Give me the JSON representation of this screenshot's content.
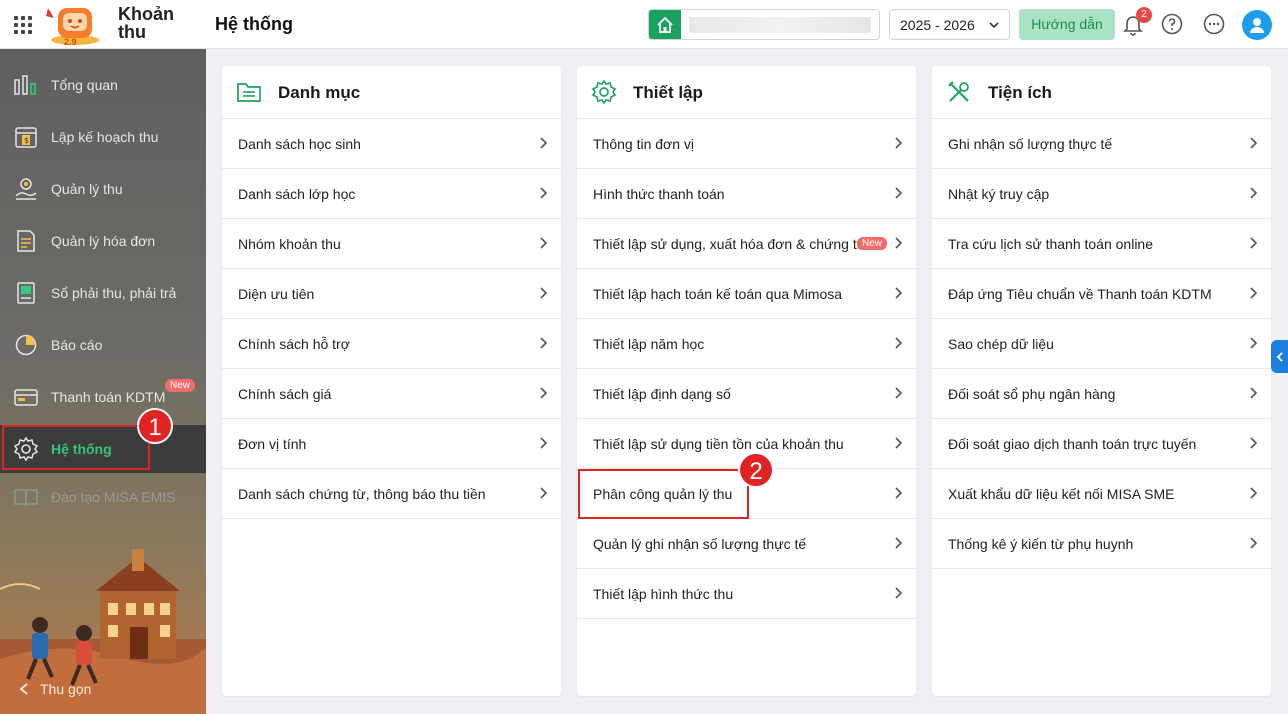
{
  "topbar": {
    "app_name_line1": "Khoản",
    "app_name_line2": "thu",
    "page_title": "Hệ thống",
    "school_year": "2025 - 2026",
    "guide_label": "Hướng dẫn",
    "notification_count": "2"
  },
  "sidebar": {
    "items": [
      {
        "label": "Tổng quan",
        "icon": "chart-bars-icon"
      },
      {
        "label": "Lập kế hoạch thu",
        "icon": "calendar-dollar-icon"
      },
      {
        "label": "Quản lý thu",
        "icon": "coin-hand-icon"
      },
      {
        "label": "Quản lý hóa đơn",
        "icon": "invoice-icon"
      },
      {
        "label": "Sổ phải thu, phải trả",
        "icon": "ledger-icon"
      },
      {
        "label": "Báo cáo",
        "icon": "pie-chart-icon"
      },
      {
        "label": "Thanh toán KDTM",
        "icon": "card-icon",
        "badge": "New"
      },
      {
        "label": "Hệ thống",
        "icon": "gear-icon"
      },
      {
        "label": "Đào tạo MISA EMIS",
        "icon": "book-icon"
      }
    ],
    "collapse_label": "Thu gọn"
  },
  "markers": {
    "one": "1",
    "two": "2"
  },
  "cards": {
    "danh_muc": {
      "title": "Danh mục",
      "rows": [
        "Danh sách học sinh",
        "Danh sách lớp học",
        "Nhóm khoản thu",
        "Diện ưu tiên",
        "Chính sách hỗ trợ",
        "Chính sách giá",
        "Đơn vị tính",
        "Danh sách chứng từ, thông báo thu tiền"
      ]
    },
    "thiet_lap": {
      "title": "Thiết lập",
      "rows": [
        "Thông tin đơn vị",
        "Hình thức thanh toán",
        "Thiết lập sử dụng, xuất hóa đơn & chứng từ",
        "Thiết lập hạch toán kế toán qua Mimosa",
        "Thiết lập năm học",
        "Thiết lập định dạng số",
        "Thiết lập sử dụng tiền tồn của khoản thu",
        "Phân công quản lý thu",
        "Quản lý ghi nhận số lượng thực tế",
        "Thiết lập hình thức thu"
      ],
      "new_badge": "New"
    },
    "tien_ich": {
      "title": "Tiện ích",
      "rows": [
        "Ghi nhận số lượng thực tế",
        "Nhật ký truy cập",
        "Tra cứu lịch sử thanh toán online",
        "Đáp ứng Tiêu chuẩn về Thanh toán KDTM",
        "Sao chép dữ liệu",
        "Đối soát sổ phụ ngân hàng",
        "Đối soát giao dịch thanh toán trực tuyến",
        "Xuất khẩu dữ liệu kết nối MISA SME",
        "Thống kê ý kiến từ phụ huynh"
      ]
    }
  },
  "colors": {
    "accent_green": "#1aa260",
    "active_text": "#35c57a",
    "highlight_red": "#e02424",
    "badge_red": "#f26b6b"
  }
}
